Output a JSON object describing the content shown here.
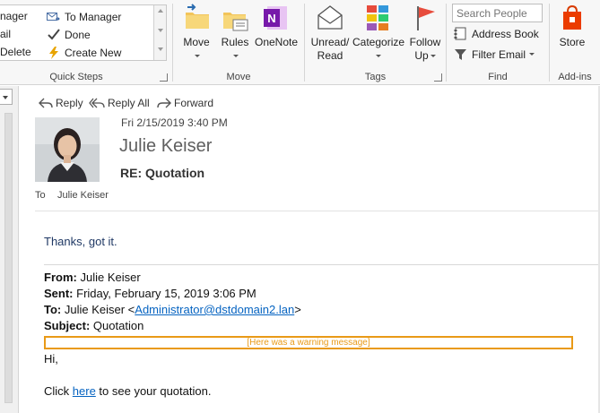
{
  "ribbon": {
    "quick_steps": {
      "items": [
        "nager",
        "To Manager",
        "ail",
        "Done",
        "Delete",
        "Create New"
      ],
      "label": "Quick Steps"
    },
    "move": {
      "move_label": "Move",
      "rules_label": "Rules",
      "onenote_label": "OneNote",
      "label": "Move"
    },
    "tags": {
      "unread_label_1": "Unread/",
      "unread_label_2": "Read",
      "categorize_label": "Categorize",
      "follow_label_1": "Follow",
      "follow_label_2": "Up",
      "label": "Tags"
    },
    "find": {
      "search_placeholder": "Search People",
      "address_book_label": "Address Book",
      "filter_email_label": "Filter Email",
      "label": "Find"
    },
    "addins": {
      "store_label": "Store",
      "label": "Add-ins"
    }
  },
  "reading": {
    "actions": {
      "reply": "Reply",
      "reply_all": "Reply All",
      "forward": "Forward"
    },
    "header": {
      "sent_date": "Fri 2/15/2019 3:40 PM",
      "sender": "Julie Keiser",
      "subject": "RE: Quotation",
      "to_label": "To",
      "to_name": "Julie Keiser"
    },
    "body": {
      "reply_text": "Thanks, got it.",
      "from_label": "From:",
      "from_value": "Julie Keiser",
      "sent_label": "Sent:",
      "sent_value": "Friday, February 15, 2019 3:06 PM",
      "to_label": "To:",
      "to_prefix": "Julie Keiser <",
      "to_email": "Administrator@dstdomain2.lan",
      "to_suffix": ">",
      "subject_label": "Subject:",
      "subject_value": "Quotation",
      "warning": "[Here was a warning message]",
      "greeting": "Hi,",
      "click_prefix": "Click ",
      "click_link": "here",
      "click_suffix": " to see your quotation."
    }
  },
  "colors": {
    "accent": "#0563c1",
    "warning": "#e99a17",
    "reply_text": "#1f3864"
  }
}
